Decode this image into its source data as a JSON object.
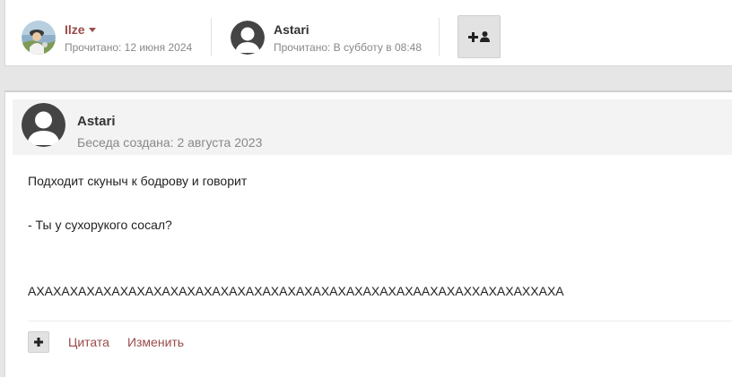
{
  "participants": [
    {
      "name": "Ilze",
      "read": "Прочитано: 12 июня 2024",
      "role": "owner"
    },
    {
      "name": "Astari",
      "read": "Прочитано: В субботу в 08:48",
      "role": "guest"
    }
  ],
  "post": {
    "author": "Astari",
    "created": "Беседа создана: 2 августа 2023",
    "lines": [
      "Подходит скуныч к бодрову и говорит",
      "- Ты у сухорукого сосал?",
      "АХАХАХАХАХАХАХАХАХАХАХАХАХАХАХАХАХАХАХАХАХАХАХААХАХАХХАХАХАХХАХА"
    ],
    "actions": {
      "quote": "Цитата",
      "edit": "Изменить"
    }
  },
  "colors": {
    "link": "#9b4b4b",
    "muted": "#888888"
  },
  "icons": {
    "add_participant": "plus-user-icon",
    "multiquote": "plus-icon",
    "menu": "caret-down-icon"
  }
}
